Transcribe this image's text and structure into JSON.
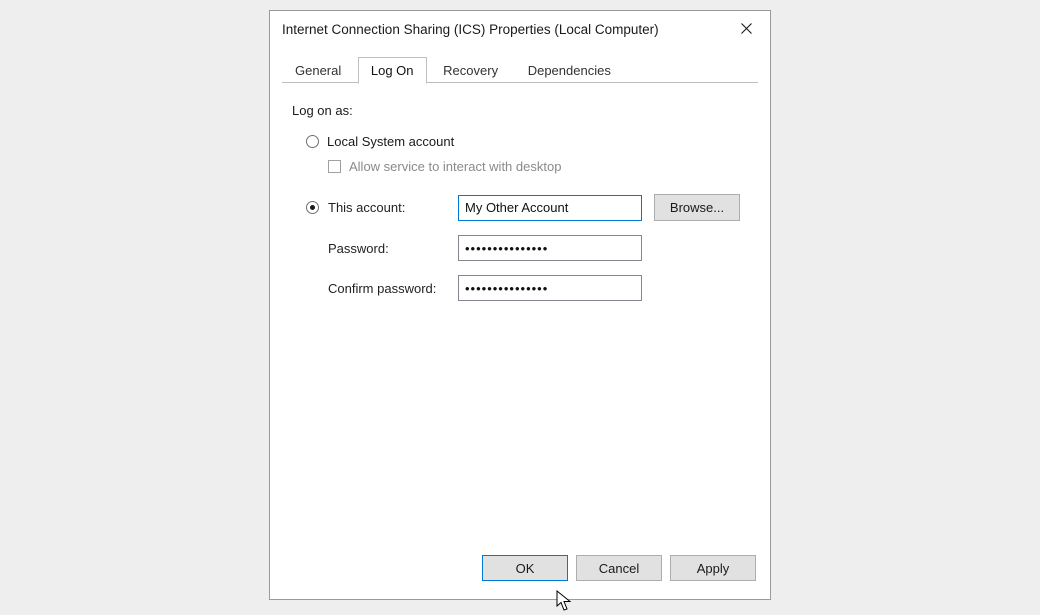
{
  "window": {
    "title": "Internet Connection Sharing (ICS) Properties (Local Computer)"
  },
  "tabs": {
    "general": "General",
    "logon": "Log On",
    "recovery": "Recovery",
    "dependencies": "Dependencies",
    "active": "logon"
  },
  "logon": {
    "heading": "Log on as:",
    "local_system_label": "Local System account",
    "allow_interact_label": "Allow service to interact with desktop",
    "this_account_label": "This account:",
    "account_value": "My Other Account",
    "browse_label": "Browse...",
    "password_label": "Password:",
    "password_value": "•••••••••••••••",
    "confirm_label": "Confirm password:",
    "confirm_value": "•••••••••••••••",
    "selected": "this_account",
    "allow_interact_checked": false
  },
  "buttons": {
    "ok": "OK",
    "cancel": "Cancel",
    "apply": "Apply"
  }
}
